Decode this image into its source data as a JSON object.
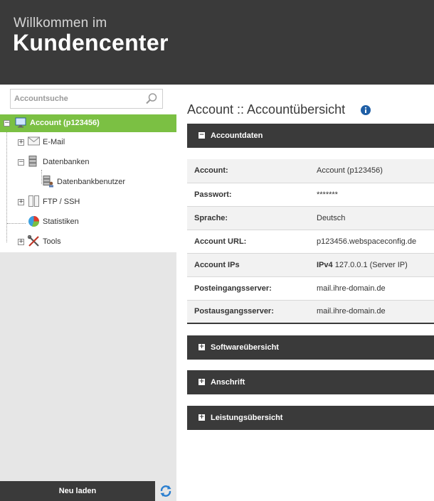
{
  "header": {
    "subtitle": "Willkommen im",
    "title": "Kundencenter"
  },
  "sidebar": {
    "search_placeholder": "Accountsuche",
    "tree": {
      "root": "Account (p123456)",
      "items": [
        {
          "label": "E-Mail",
          "icon": "mail-icon"
        },
        {
          "label": "Datenbanken",
          "icon": "database-icon"
        },
        {
          "label": "Datenbankbenutzer",
          "icon": "database-user-icon"
        },
        {
          "label": "FTP / SSH",
          "icon": "ftp-icon"
        },
        {
          "label": "Statistiken",
          "icon": "pie-chart-icon"
        },
        {
          "label": "Tools",
          "icon": "tools-icon"
        }
      ]
    },
    "reload_label": "Neu laden"
  },
  "content": {
    "page_title": "Account :: Accountübersicht",
    "panels": {
      "accountdaten": "Accountdaten",
      "software": "Softwareübersicht",
      "anschrift": "Anschrift",
      "leistung": "Leistungsübersicht"
    },
    "account_rows": [
      {
        "key": "Account:",
        "value": "Account (p123456)"
      },
      {
        "key": "Passwort:",
        "value": "*******"
      },
      {
        "key": "Sprache:",
        "value": "Deutsch"
      },
      {
        "key": "Account URL:",
        "value": "p123456.webspaceconfig.de"
      },
      {
        "key": "Account IPs",
        "value_prefix": "IPv4",
        "value": "127.0.0.1 (Server IP)"
      },
      {
        "key": "Posteingangsserver:",
        "value": "mail.ihre-domain.de"
      },
      {
        "key": "Postausgangsserver:",
        "value": "mail.ihre-domain.de"
      }
    ]
  },
  "colors": {
    "header_bg": "#3a3a3a",
    "accent_green": "#7bc043",
    "sidebar_bg": "#e6e6e6",
    "info_blue": "#1f5fa6"
  }
}
